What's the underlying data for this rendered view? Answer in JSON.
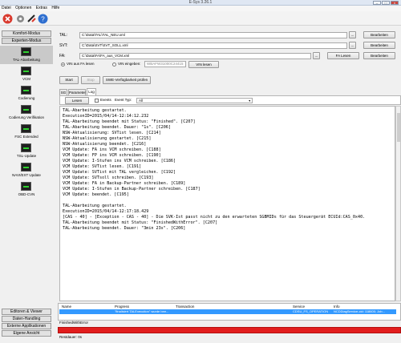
{
  "window": {
    "title": "E-Sys 3.26.1",
    "minimize": "–",
    "maximize": "□",
    "close": "x"
  },
  "menu": [
    "Datei",
    "Optionen",
    "Extras",
    "Hilfe"
  ],
  "toolbar_icons": [
    "exit-icon",
    "settings-icon",
    "connection-icon",
    "help-icon"
  ],
  "sidebar": {
    "top_buttons": [
      "Komfort-Modus",
      "Experten-Modus"
    ],
    "nav_items": [
      {
        "label": "TAL-Abarbeitung",
        "icon": "tal-icon",
        "selected": true
      },
      {
        "label": "VCM",
        "icon": "vcm-icon",
        "selected": false
      },
      {
        "label": "Codierung",
        "icon": "coding-icon",
        "selected": false
      },
      {
        "label": "Codierung Verifikation",
        "icon": "coding-verify-icon",
        "selected": false
      },
      {
        "label": "FSC Extended",
        "icon": "fsc-icon",
        "selected": false
      },
      {
        "label": "TSL-Update",
        "icon": "tsl-icon",
        "selected": false
      },
      {
        "label": "NAVI/EXT Update",
        "icon": "navi-icon",
        "selected": false
      },
      {
        "label": "OBD-CVN",
        "icon": "obd-icon",
        "selected": false
      }
    ],
    "bottom_buttons": [
      "Editoren & Viewer",
      "Daten-Handling",
      "Externe Applikationen",
      "Eigene Ansicht"
    ]
  },
  "form": {
    "tal_label": "TAL:",
    "tal_value": "C:\\Data\\TAL\\TAL_NEU.xml",
    "svt_label": "SVT:",
    "svt_value": "C:\\Data\\SVT\\SVT_SOLL.xml",
    "fa_label": "FA:",
    "fa_value": "C:\\Data\\FA\\FA_aus_VCM.xml",
    "dots": "...",
    "edit": "Bearbeiten",
    "fa_read": "FA Lesen",
    "radio_vin_fa": "VIN aus FA lesen",
    "radio_vin_input": "VIN eingeben:",
    "vin_value": "WBAFW31000C24415",
    "vin_read": "VIN lesen"
  },
  "actions": {
    "start": "Start",
    "stop": "Stop",
    "check": "SWE-Verfügbarkeit prüfen"
  },
  "tabs": [
    "SG",
    "Parameter",
    "Log"
  ],
  "log_toolbar": {
    "read": "Lesen",
    "events": "Events",
    "event_type_label": "Event Typ:",
    "event_type_value": "All"
  },
  "log_lines": [
    "TAL-Abarbeitung gestartet.",
    "ExecutionID=2015/04/14-12:14:12.232",
    "TAL-Abarbeitung beendet mit Status: \"Finished\". [C207]",
    "TAL-Abarbeitung beendet. Dauer: \"1s\". [C206]",
    "NSW-Aktualisierung: SVTist lesen. [C214]",
    "NSW-Aktualisierung gestartet. [C215]",
    "NSW-Aktualisierung beendet. [C216]",
    "VCM Update: FA ins VCM schreiben. [C188]",
    "VCM Update: FP ins VCM schreiben. [C190]",
    "VCM Update: I-Stufen ins VCM schreiben. [C186]",
    "VCM Update: SVTist lesen. [C191]",
    "VCM Update: SVTist mit TAL vergleichen. [C192]",
    "VCM Update: SVTsoll schreiben. [C193]",
    "VCM Update: FA in Backup-Partner schreiben. [C189]",
    "VCM Update: I-Stufen in Backup-Partner schreiben. [C187]",
    "VCM Update: beendet. [C195]",
    "",
    "TAL-Abarbeitung gestartet.",
    "ExecutionID=2015/04/14-12:17:18.429",
    "[CAS - 40] - [Exception - CAS - 40] - Die SVK-Ist passt nicht zu den erwarteten SGBMIDs für das Steuergerät ECUId:CAS_0x40.",
    "TAL-Abarbeitung beendet mit Status: \"FinishedWithError\". [C207]",
    "TAL-Abarbeitung beendet. Dauer: \"3min 23s\". [C206]"
  ],
  "tasks": {
    "headers": [
      "Name",
      "Progress",
      "Transaction",
      "Service",
      "Info"
    ],
    "row": {
      "name": "",
      "progress": "\"finalisiert TALExecution\" wurde bee...",
      "transaction": "",
      "service": "CDSU_FS_OPERATION",
      "info": "NCDDiagService-cid: 118600; Job..."
    }
  },
  "status": {
    "state": "FinishedWithError",
    "progress_fraction": 1.0,
    "progress_color": "#e21d1d",
    "remaining": "Restdauer: 0s"
  }
}
